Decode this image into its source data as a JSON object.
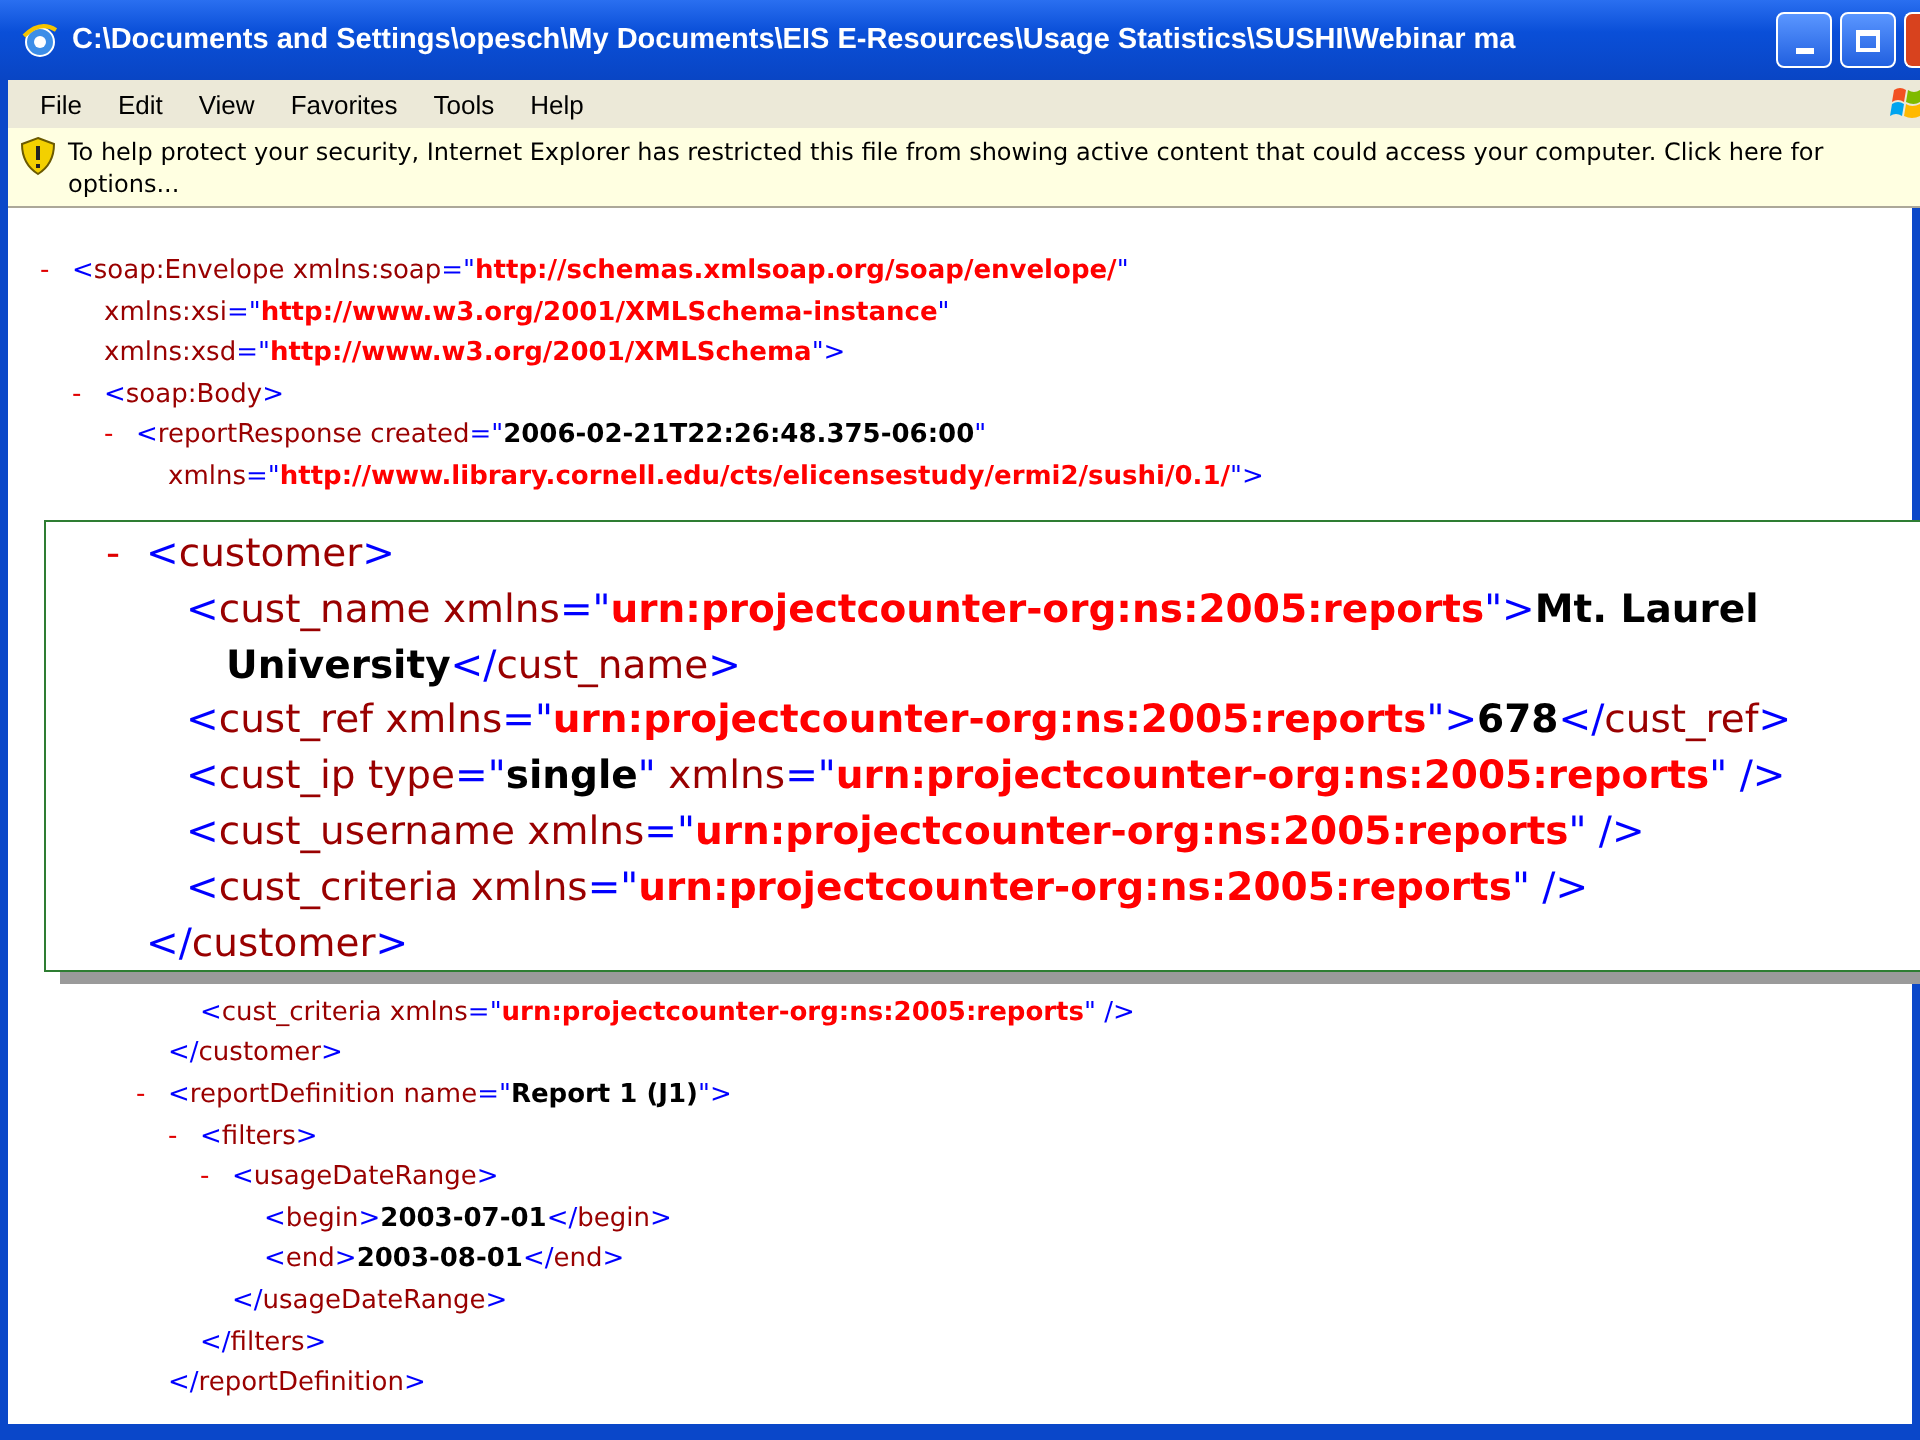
{
  "window": {
    "title": "C:\\Documents and Settings\\opesch\\My Documents\\EIS E-Resources\\Usage Statistics\\SUSHI\\Webinar ma"
  },
  "menu": [
    "File",
    "Edit",
    "View",
    "Favorites",
    "Tools",
    "Help"
  ],
  "info_bar": {
    "text": "To help protect your security, Internet Explorer has restricted this file from showing active content that could access your computer. Click here for options..."
  },
  "document": [
    {
      "toggle": "-",
      "lines": [
        [
          {
            "kind": "mark",
            "text": "<"
          },
          {
            "kind": "tag",
            "text": "soap:Envelope"
          },
          {
            "kind": "attr",
            "text": " xmlns:soap"
          },
          {
            "kind": "mark",
            "text": "=\""
          },
          {
            "kind": "ns",
            "text": "http://schemas.xmlsoap.org/soap/envelope/"
          },
          {
            "kind": "mark",
            "text": "\""
          }
        ],
        [
          {
            "kind": "attr",
            "text": "xmlns:xsi"
          },
          {
            "kind": "mark",
            "text": "=\""
          },
          {
            "kind": "ns",
            "text": "http://www.w3.org/2001/XMLSchema-instance"
          },
          {
            "kind": "mark",
            "text": "\""
          }
        ],
        [
          {
            "kind": "attr",
            "text": "xmlns:xsd"
          },
          {
            "kind": "mark",
            "text": "=\""
          },
          {
            "kind": "ns",
            "text": "http://www.w3.org/2001/XMLSchema"
          },
          {
            "kind": "mark",
            "text": "\">"
          }
        ]
      ],
      "children": [
        {
          "toggle": "-",
          "lines": [
            [
              {
                "kind": "mark",
                "text": "<"
              },
              {
                "kind": "tag",
                "text": "soap:Body"
              },
              {
                "kind": "mark",
                "text": ">"
              }
            ]
          ],
          "children": [
            {
              "toggle": "-",
              "lines": [
                [
                  {
                    "kind": "mark",
                    "text": "<"
                  },
                  {
                    "kind": "tag",
                    "text": "reportResponse"
                  },
                  {
                    "kind": "attr",
                    "text": " created"
                  },
                  {
                    "kind": "mark",
                    "text": "=\""
                  },
                  {
                    "kind": "value",
                    "text": "2006-02-21T22:26:48.375-06:00"
                  },
                  {
                    "kind": "mark",
                    "text": "\""
                  }
                ],
                [
                  {
                    "kind": "attr",
                    "text": "xmlns"
                  },
                  {
                    "kind": "mark",
                    "text": "=\""
                  },
                  {
                    "kind": "ns",
                    "text": "http://www.library.cornell.edu/cts/elicensestudy/ermi2/sushi/0.1/"
                  },
                  {
                    "kind": "mark",
                    "text": "\">"
                  }
                ]
              ],
              "children": [
                {
                  "children": [
                    {
                      "lines": [
                        [
                          {
                            "kind": "mark",
                            "text": "<"
                          },
                          {
                            "kind": "tag",
                            "text": "cust_criteria"
                          },
                          {
                            "kind": "attr",
                            "text": " xmlns"
                          },
                          {
                            "kind": "mark",
                            "text": "=\""
                          },
                          {
                            "kind": "ns",
                            "text": "urn:projectcounter-org:ns:2005:reports"
                          },
                          {
                            "kind": "mark",
                            "text": "\" />"
                          }
                        ]
                      ]
                    }
                  ],
                  "closing": [
                    {
                      "kind": "mark",
                      "text": "</"
                    },
                    {
                      "kind": "tag",
                      "text": "customer"
                    },
                    {
                      "kind": "mark",
                      "text": ">"
                    }
                  ]
                },
                {
                  "toggle": "-",
                  "lines": [
                    [
                      {
                        "kind": "mark",
                        "text": "<"
                      },
                      {
                        "kind": "tag",
                        "text": "reportDefinition"
                      },
                      {
                        "kind": "attr",
                        "text": " name"
                      },
                      {
                        "kind": "mark",
                        "text": "=\""
                      },
                      {
                        "kind": "value",
                        "text": "Report 1 (J1)"
                      },
                      {
                        "kind": "mark",
                        "text": "\">"
                      }
                    ]
                  ],
                  "children": [
                    {
                      "toggle": "-",
                      "lines": [
                        [
                          {
                            "kind": "mark",
                            "text": "<"
                          },
                          {
                            "kind": "tag",
                            "text": "filters"
                          },
                          {
                            "kind": "mark",
                            "text": ">"
                          }
                        ]
                      ],
                      "children": [
                        {
                          "toggle": "-",
                          "lines": [
                            [
                              {
                                "kind": "mark",
                                "text": "<"
                              },
                              {
                                "kind": "tag",
                                "text": "usageDateRange"
                              },
                              {
                                "kind": "mark",
                                "text": ">"
                              }
                            ]
                          ],
                          "children": [
                            {
                              "lines": [
                                [
                                  {
                                    "kind": "mark",
                                    "text": "<"
                                  },
                                  {
                                    "kind": "tag",
                                    "text": "begin"
                                  },
                                  {
                                    "kind": "mark",
                                    "text": ">"
                                  },
                                  {
                                    "kind": "text",
                                    "text": "2003-07-01"
                                  },
                                  {
                                    "kind": "mark",
                                    "text": "</"
                                  },
                                  {
                                    "kind": "tag",
                                    "text": "begin"
                                  },
                                  {
                                    "kind": "mark",
                                    "text": ">"
                                  }
                                ]
                              ]
                            },
                            {
                              "lines": [
                                [
                                  {
                                    "kind": "mark",
                                    "text": "<"
                                  },
                                  {
                                    "kind": "tag",
                                    "text": "end"
                                  },
                                  {
                                    "kind": "mark",
                                    "text": ">"
                                  },
                                  {
                                    "kind": "text",
                                    "text": "2003-08-01"
                                  },
                                  {
                                    "kind": "mark",
                                    "text": "</"
                                  },
                                  {
                                    "kind": "tag",
                                    "text": "end"
                                  },
                                  {
                                    "kind": "mark",
                                    "text": ">"
                                  }
                                ]
                              ]
                            }
                          ],
                          "closing": [
                            {
                              "kind": "mark",
                              "text": "</"
                            },
                            {
                              "kind": "tag",
                              "text": "usageDateRange"
                            },
                            {
                              "kind": "mark",
                              "text": ">"
                            }
                          ]
                        }
                      ],
                      "closing": [
                        {
                          "kind": "mark",
                          "text": "</"
                        },
                        {
                          "kind": "tag",
                          "text": "filters"
                        },
                        {
                          "kind": "mark",
                          "text": ">"
                        }
                      ]
                    }
                  ],
                  "closing": [
                    {
                      "kind": "mark",
                      "text": "</"
                    },
                    {
                      "kind": "tag",
                      "text": "reportDefinition"
                    },
                    {
                      "kind": "mark",
                      "text": ">"
                    }
                  ]
                }
              ]
            }
          ]
        }
      ]
    }
  ],
  "zoom_callout": [
    {
      "toggle": "-",
      "lines": [
        [
          {
            "kind": "mark",
            "text": "<"
          },
          {
            "kind": "tag",
            "text": "customer"
          },
          {
            "kind": "mark",
            "text": ">"
          }
        ]
      ],
      "children": [
        {
          "lines": [
            [
              {
                "kind": "mark",
                "text": "<"
              },
              {
                "kind": "tag",
                "text": "cust_name"
              },
              {
                "kind": "attr",
                "text": " xmlns"
              },
              {
                "kind": "mark",
                "text": "=\""
              },
              {
                "kind": "ns",
                "text": "urn:projectcounter-org:ns:2005:reports"
              },
              {
                "kind": "mark",
                "text": "\">"
              },
              {
                "kind": "text",
                "text": "Mt. Laurel"
              }
            ],
            [
              {
                "kind": "text",
                "text": "University"
              },
              {
                "kind": "mark",
                "text": "</"
              },
              {
                "kind": "tag",
                "text": "cust_name"
              },
              {
                "kind": "mark",
                "text": ">"
              }
            ]
          ]
        },
        {
          "lines": [
            [
              {
                "kind": "mark",
                "text": "<"
              },
              {
                "kind": "tag",
                "text": "cust_ref"
              },
              {
                "kind": "attr",
                "text": " xmlns"
              },
              {
                "kind": "mark",
                "text": "=\""
              },
              {
                "kind": "ns",
                "text": "urn:projectcounter-org:ns:2005:reports"
              },
              {
                "kind": "mark",
                "text": "\">"
              },
              {
                "kind": "text",
                "text": "678"
              },
              {
                "kind": "mark",
                "text": "</"
              },
              {
                "kind": "tag",
                "text": "cust_ref"
              },
              {
                "kind": "mark",
                "text": ">"
              }
            ]
          ]
        },
        {
          "lines": [
            [
              {
                "kind": "mark",
                "text": "<"
              },
              {
                "kind": "tag",
                "text": "cust_ip"
              },
              {
                "kind": "attr",
                "text": " type"
              },
              {
                "kind": "mark",
                "text": "=\""
              },
              {
                "kind": "value",
                "text": "single"
              },
              {
                "kind": "mark",
                "text": "\""
              },
              {
                "kind": "attr",
                "text": " xmlns"
              },
              {
                "kind": "mark",
                "text": "=\""
              },
              {
                "kind": "ns",
                "text": "urn:projectcounter-org:ns:2005:reports"
              },
              {
                "kind": "mark",
                "text": "\" />"
              }
            ]
          ]
        },
        {
          "lines": [
            [
              {
                "kind": "mark",
                "text": "<"
              },
              {
                "kind": "tag",
                "text": "cust_username"
              },
              {
                "kind": "attr",
                "text": " xmlns"
              },
              {
                "kind": "mark",
                "text": "=\""
              },
              {
                "kind": "ns",
                "text": "urn:projectcounter-org:ns:2005:reports"
              },
              {
                "kind": "mark",
                "text": "\" />"
              }
            ]
          ]
        },
        {
          "lines": [
            [
              {
                "kind": "mark",
                "text": "<"
              },
              {
                "kind": "tag",
                "text": "cust_criteria"
              },
              {
                "kind": "attr",
                "text": " xmlns"
              },
              {
                "kind": "mark",
                "text": "=\""
              },
              {
                "kind": "ns",
                "text": "urn:projectcounter-org:ns:2005:reports"
              },
              {
                "kind": "mark",
                "text": "\" />"
              }
            ]
          ]
        }
      ],
      "closing": [
        {
          "kind": "mark",
          "text": "</"
        },
        {
          "kind": "tag",
          "text": "customer"
        },
        {
          "kind": "mark",
          "text": ">"
        }
      ]
    }
  ]
}
